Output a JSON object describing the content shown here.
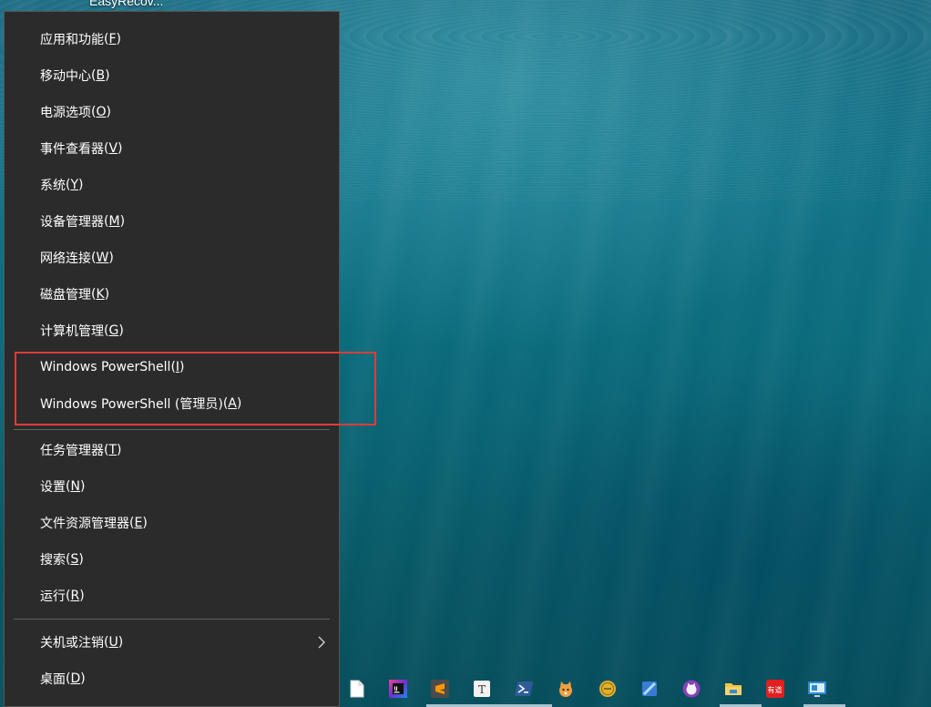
{
  "desktop": {
    "partial_label": "EasyRecov..."
  },
  "menu": {
    "group1": [
      {
        "label": "应用和功能",
        "key": "F"
      },
      {
        "label": "移动中心",
        "key": "B"
      },
      {
        "label": "电源选项",
        "key": "O"
      },
      {
        "label": "事件查看器",
        "key": "V"
      },
      {
        "label": "系统",
        "key": "Y"
      },
      {
        "label": "设备管理器",
        "key": "M"
      },
      {
        "label": "网络连接",
        "key": "W"
      },
      {
        "label": "磁盘管理",
        "key": "K"
      },
      {
        "label": "计算机管理",
        "key": "G"
      },
      {
        "label": "Windows PowerShell",
        "key": "I"
      },
      {
        "label": "Windows PowerShell (管理员)",
        "key": "A"
      }
    ],
    "group2": [
      {
        "label": "任务管理器",
        "key": "T"
      },
      {
        "label": "设置",
        "key": "N"
      },
      {
        "label": "文件资源管理器",
        "key": "E"
      },
      {
        "label": "搜索",
        "key": "S"
      },
      {
        "label": "运行",
        "key": "R"
      }
    ],
    "group3": [
      {
        "label": "关机或注销",
        "key": "U",
        "has_submenu": true
      },
      {
        "label": "桌面",
        "key": "D"
      }
    ]
  },
  "taskbar": {
    "icons": [
      {
        "name": "file-icon",
        "color": "#ffffff"
      },
      {
        "name": "intellij-icon",
        "color": "#6b2fd1"
      },
      {
        "name": "sublime-icon",
        "color": "#ff9800"
      },
      {
        "name": "typora-icon",
        "color": "#f2f2f2"
      },
      {
        "name": "powershell-icon",
        "color": "#2d5b9a"
      },
      {
        "name": "cat-app-icon",
        "color": "#f0a040"
      },
      {
        "name": "coin-app-icon",
        "color": "#e0b030"
      },
      {
        "name": "blue-app-icon",
        "color": "#3a7bd5"
      },
      {
        "name": "purple-cat-icon",
        "color": "#8a3fb8"
      },
      {
        "name": "file-explorer-icon",
        "color": "#f4c542"
      },
      {
        "name": "youdao-icon",
        "color": "#e02020",
        "text": "有道"
      },
      {
        "name": "remote-desktop-icon",
        "color": "#2a8ad4"
      }
    ]
  }
}
